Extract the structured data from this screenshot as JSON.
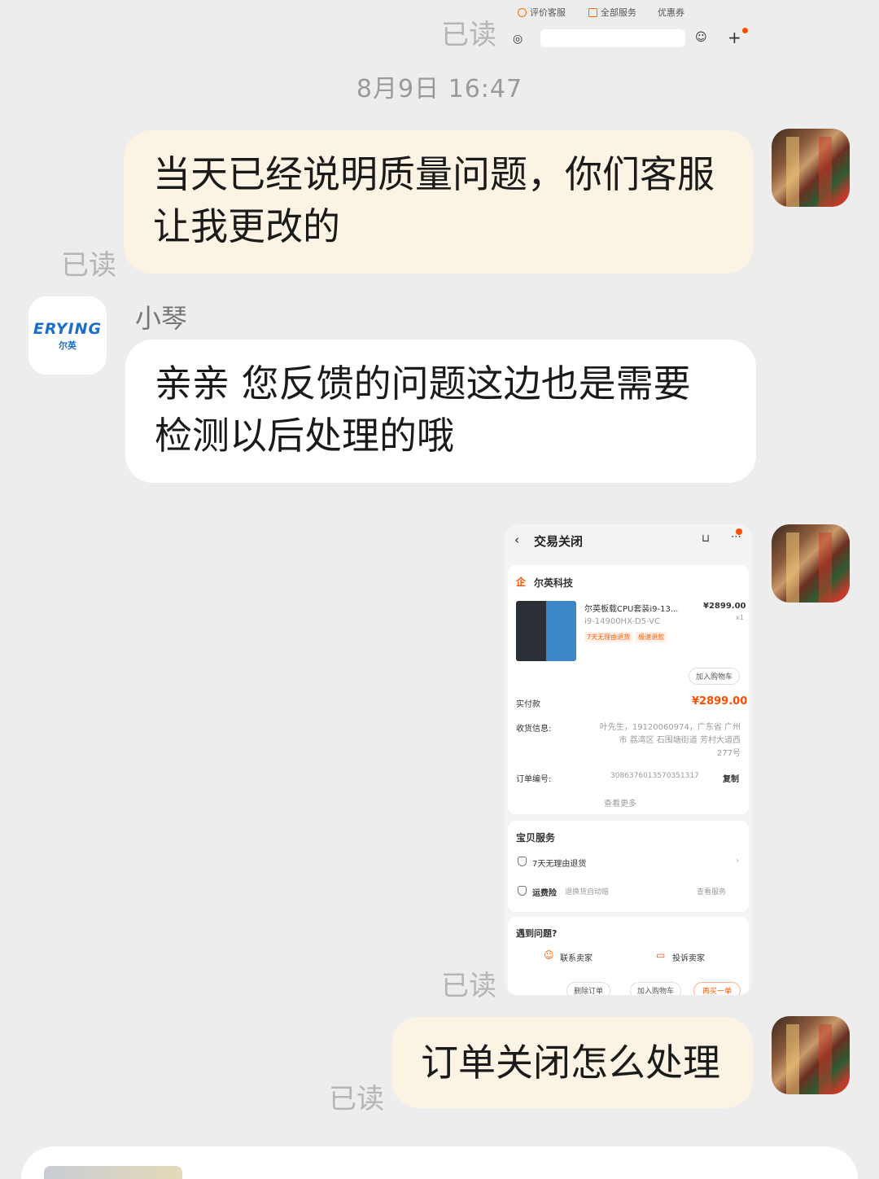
{
  "top_strip": {
    "chips": [
      "评价客服",
      "全部服务",
      "优惠券"
    ],
    "read": "已读"
  },
  "timestamp": "8月9日 16:47",
  "messages": [
    {
      "side": "me",
      "lines": [
        "当天已经说明质量问题，你们客服",
        "让我更改的"
      ],
      "read": "已读"
    },
    {
      "side": "them",
      "sender": "小琴",
      "lines": [
        "亲亲 您反馈的问题这边也是需要",
        "检测以后处理的哦"
      ]
    },
    {
      "side": "me",
      "type": "image",
      "read": "已读"
    },
    {
      "side": "me",
      "lines": [
        "订单关闭怎么处理"
      ],
      "read": "已读"
    }
  ],
  "shop_avatar": {
    "en": "ERYING",
    "cn": "尔英"
  },
  "order_screenshot": {
    "title": "交易关闭",
    "shop_name": "尔英科技",
    "product_name": "尔英板载CPU套装i9-13...",
    "product_price": "¥2899.00",
    "product_qty": "x1",
    "product_sku": "i9-14900HX-D5-VC",
    "tags": [
      "7天无理由退货",
      "极速退款"
    ],
    "add_cart_small": "加入购物车",
    "paid_label": "实付款",
    "paid_value": "¥2899.00",
    "address_label": "收货信息:",
    "address_lines": [
      "叶先生，19120060974，广东省 广州",
      "市 荔湾区 石围塘街道 芳村大道西",
      "277号"
    ],
    "order_no_label": "订单编号:",
    "order_no": "3086376013570351317",
    "copy": "复制",
    "see_more": "查看更多",
    "service_title": "宝贝服务",
    "service_1": "7天无理由退货",
    "service_2": "运费险",
    "service_2_sub": "退换货自动赔",
    "service_2_link": "查看服务",
    "problem_title": "遇到问题?",
    "contact_seller": "联系卖家",
    "complain_seller": "投诉卖家",
    "btn_delete": "删除订单",
    "btn_cart": "加入购物车",
    "btn_rebuy": "再买一单"
  },
  "colors": {
    "my_bubble": "#fbf3e3",
    "their_bubble": "#ffffff",
    "background": "#ededed",
    "accent": "#ff4d00",
    "brand_blue": "#1c6fc7"
  }
}
